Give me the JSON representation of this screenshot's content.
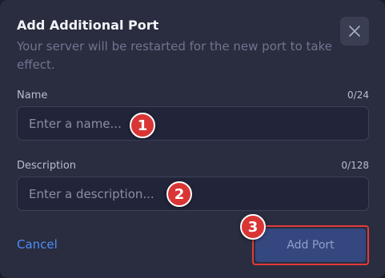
{
  "dialog": {
    "title": "Add Additional Port",
    "subtitle": "Your server will be restarted for the new port to take effect."
  },
  "name_field": {
    "label": "Name",
    "counter": "0/24",
    "value": "",
    "placeholder": "Enter a name..."
  },
  "description_field": {
    "label": "Description",
    "counter": "0/128",
    "value": "",
    "placeholder": "Enter a description..."
  },
  "actions": {
    "cancel_label": "Cancel",
    "submit_label": "Add Port"
  },
  "annotations": [
    "1",
    "2",
    "3"
  ],
  "icons": {
    "close": "close-icon"
  },
  "colors": {
    "accent_link": "#4d8ef7",
    "badge": "#d93535",
    "highlight_outline": "#e03b3b",
    "submit_button": "#34477e"
  }
}
